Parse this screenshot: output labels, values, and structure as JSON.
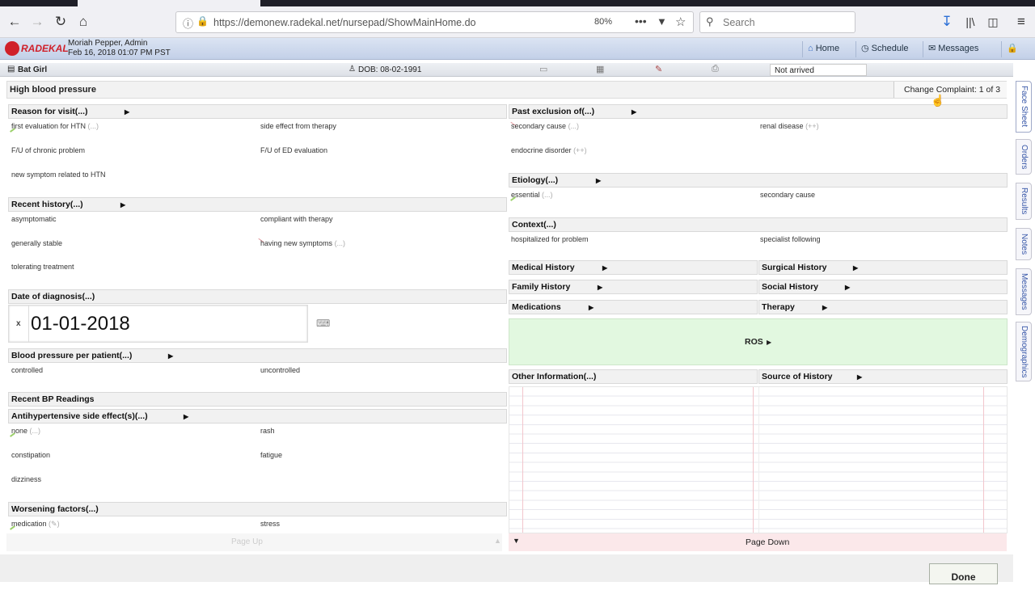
{
  "browser": {
    "url": "https://demonew.radekal.net/nursepad/ShowMainHome.do",
    "zoom": "80%",
    "search_placeholder": "Search"
  },
  "header": {
    "logo_text": "RADEKAL",
    "user_name": "Moriah Pepper, Admin",
    "datetime": "Feb 16, 2018 01:07 PM PST",
    "nav": [
      "Home",
      "Schedule",
      "Messages"
    ]
  },
  "patient": {
    "name": "Bat Girl",
    "dob": "DOB: 08-02-1991",
    "status": "Not arrived"
  },
  "complaint": {
    "title": "High blood pressure",
    "change_label": "Change Complaint: 1 of 3"
  },
  "left": {
    "reason": {
      "title": "Reason for visit(...)",
      "options": [
        "first evaluation for HTN",
        "side effect from therapy",
        "F/U of chronic problem",
        "F/U of ED evaluation",
        "new symptom related to HTN"
      ],
      "ellipsis": "(...)"
    },
    "recent_history": {
      "title": "Recent history(...)",
      "options": [
        "asymptomatic",
        "compliant with therapy",
        "generally stable",
        "having new symptoms",
        "tolerating treatment"
      ],
      "ellipsis": "(...)"
    },
    "date_of_diagnosis": {
      "title": "Date of diagnosis(...)",
      "clear": "x",
      "value": "01-01-2018"
    },
    "bp_per_patient": {
      "title": "Blood pressure per patient(...)",
      "options": [
        "controlled",
        "uncontrolled"
      ]
    },
    "recent_bp": {
      "title": "Recent BP Readings"
    },
    "side_effects": {
      "title": "Antihypertensive side effect(s)(...)",
      "options": [
        "none",
        "rash",
        "constipation",
        "fatigue",
        "dizziness"
      ],
      "ellipsis": "(...)"
    },
    "worsening": {
      "title": "Worsening factors(...)",
      "options": [
        "medication",
        "stress"
      ],
      "edit_mark": "(✎)"
    }
  },
  "right": {
    "past_exclusion": {
      "title": "Past exclusion of(...)",
      "options": [
        "secondary cause",
        "renal disease",
        "endocrine disorder"
      ],
      "ellipsis": "(...)",
      "plus": "(++)"
    },
    "etiology": {
      "title": "Etiology(...)",
      "options": [
        "essential",
        "secondary cause"
      ],
      "ellipsis": "(...)"
    },
    "context": {
      "title": "Context(...)",
      "options": [
        "hospitalized for problem",
        "specialist following"
      ]
    },
    "history_buttons": [
      "Medical History",
      "Surgical History",
      "Family History",
      "Social History",
      "Medications",
      "Therapy"
    ],
    "ros": "ROS",
    "other_info": "Other Information(...)",
    "source_history": "Source of History"
  },
  "side_tabs": [
    "Face Sheet",
    "Orders",
    "Results",
    "Notes",
    "Messages",
    "Demographics"
  ],
  "footer": {
    "page_up": "Page Up",
    "page_down": "Page Down",
    "done": "Done"
  },
  "colors": {
    "header_blue": "#c3d0e8",
    "ros_green": "#e2f8e0",
    "page_down_pink": "#fbe8ea",
    "logo_red": "#d0202a",
    "tab_text_blue": "#3656a8"
  }
}
